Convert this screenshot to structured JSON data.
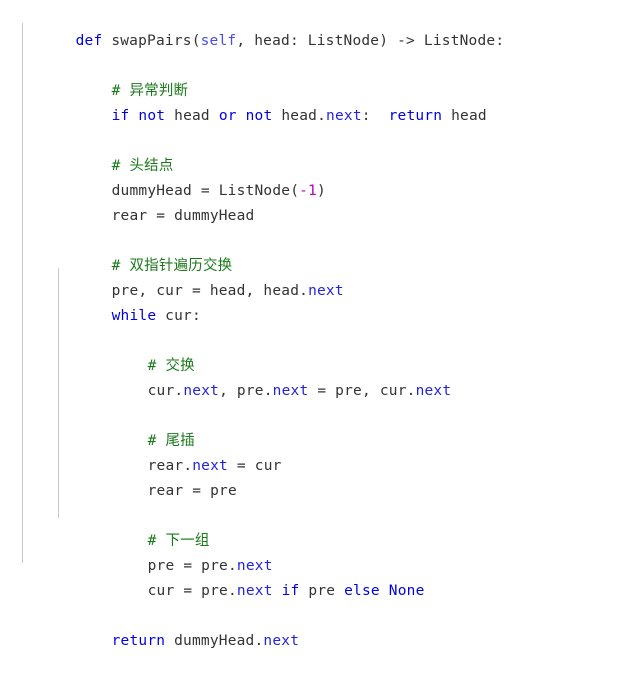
{
  "editor": {
    "language": "python",
    "background_color": "#ffffff",
    "indent_guide_color": "#c8c8c8",
    "palette": {
      "keyword": "#0000e6",
      "self": "#4a4ae8",
      "attribute": "#2323dd",
      "identifier": "#333333",
      "comment": "#1a7a1a",
      "number": "#b800b8"
    }
  },
  "code": {
    "lines": [
      {
        "indent": 0,
        "text": "def swapPairs(self, head: ListNode) -> ListNode:"
      },
      {
        "indent": 0,
        "text": ""
      },
      {
        "indent": 4,
        "text": "# 异常判断"
      },
      {
        "indent": 4,
        "text": "if not head or not head.next:  return head"
      },
      {
        "indent": 0,
        "text": ""
      },
      {
        "indent": 4,
        "text": "# 头结点"
      },
      {
        "indent": 4,
        "text": "dummyHead = ListNode(-1)"
      },
      {
        "indent": 4,
        "text": "rear = dummyHead"
      },
      {
        "indent": 0,
        "text": ""
      },
      {
        "indent": 4,
        "text": "# 双指针遍历交换"
      },
      {
        "indent": 4,
        "text": "pre, cur = head, head.next"
      },
      {
        "indent": 4,
        "text": "while cur:"
      },
      {
        "indent": 0,
        "text": ""
      },
      {
        "indent": 8,
        "text": "# 交换"
      },
      {
        "indent": 8,
        "text": "cur.next, pre.next = pre, cur.next"
      },
      {
        "indent": 0,
        "text": ""
      },
      {
        "indent": 8,
        "text": "# 尾插"
      },
      {
        "indent": 8,
        "text": "rear.next = cur"
      },
      {
        "indent": 8,
        "text": "rear = pre"
      },
      {
        "indent": 0,
        "text": ""
      },
      {
        "indent": 8,
        "text": "# 下一组"
      },
      {
        "indent": 8,
        "text": "pre = pre.next"
      },
      {
        "indent": 8,
        "text": "cur = pre.next if pre else None"
      },
      {
        "indent": 0,
        "text": ""
      },
      {
        "indent": 4,
        "text": "return dummyHead.next"
      }
    ],
    "tokens": {
      "l1": {
        "kw_def": "def",
        "fn": " swapPairs(",
        "self": "self",
        "rest": ", head: ListNode) -> ListNode:"
      },
      "l3": {
        "comment": "# 异常判断"
      },
      "l4": {
        "kw_if": "if",
        "kw_not1": "not",
        "id_head1": "head",
        "kw_or": "or",
        "kw_not2": "not",
        "id_head2": "head",
        "dot": ".",
        "attr_next": "next",
        "colon": ":",
        "kw_return": "return",
        "id_head3": "head"
      },
      "l6": {
        "comment": "# 头结点"
      },
      "l7": {
        "id_dummy": "dummyHead = ListNode(",
        "num": "-1",
        "close": ")"
      },
      "l8": {
        "text": "rear = dummyHead"
      },
      "l10": {
        "comment": "# 双指针遍历交换"
      },
      "l11": {
        "pre": "pre, cur = head, head.",
        "attr_next": "next"
      },
      "l12": {
        "kw_while": "while",
        "id_cur": " cur:"
      },
      "l14": {
        "comment": "# 交换"
      },
      "l15": {
        "a": "cur.",
        "n1": "next",
        "b": ", pre.",
        "n2": "next",
        "c": " = pre, cur.",
        "n3": "next"
      },
      "l17": {
        "comment": "# 尾插"
      },
      "l18": {
        "a": "rear.",
        "n1": "next",
        "b": " = cur"
      },
      "l19": {
        "text": "rear = pre"
      },
      "l21": {
        "comment": "# 下一组"
      },
      "l22": {
        "a": "pre = pre.",
        "n1": "next"
      },
      "l23": {
        "a": "cur = pre.",
        "n1": "next",
        "b": " ",
        "kw_if": "if",
        "c": " pre ",
        "kw_else": "else",
        "d": " ",
        "kw_none": "None"
      },
      "l25": {
        "kw_return": "return",
        "a": " dummyHead.",
        "n1": "next"
      }
    }
  }
}
